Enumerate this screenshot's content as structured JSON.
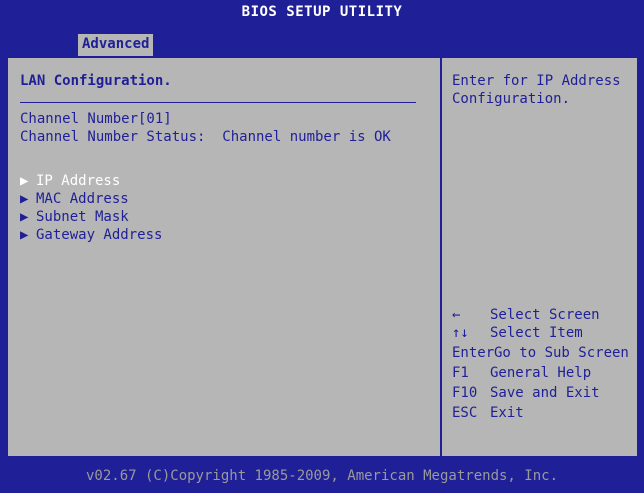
{
  "title_bar": {
    "title": "BIOS SETUP UTILITY"
  },
  "tabs": [
    {
      "label": "Advanced",
      "active": true
    }
  ],
  "main": {
    "section_title": "LAN Configuration.",
    "channel_number": "Channel Number[01]",
    "channel_status": "Channel Number Status:  Channel number is OK",
    "menu_items": [
      {
        "arrow": "▶",
        "label": "IP Address",
        "selected": true
      },
      {
        "arrow": "▶",
        "label": "MAC Address",
        "selected": false
      },
      {
        "arrow": "▶",
        "label": "Subnet Mask",
        "selected": false
      },
      {
        "arrow": "▶",
        "label": "Gateway Address",
        "selected": false
      }
    ]
  },
  "help": {
    "line1": "Enter for IP Address",
    "line2": "Configuration.",
    "keys": [
      {
        "key": "←",
        "action": "Select Screen"
      },
      {
        "key": "↑↓",
        "action": "Select Item"
      },
      {
        "key": "Enter",
        "action": "Go to Sub Screen"
      },
      {
        "key": "F1",
        "action": "General Help"
      },
      {
        "key": "F10",
        "action": "Save and Exit"
      },
      {
        "key": "ESC",
        "action": "Exit"
      }
    ]
  },
  "footer": {
    "text": "v02.67 (C)Copyright 1985-2009, American Megatrends, Inc."
  },
  "colors": {
    "background_blue": "#1f1f97",
    "panel_gray": "#b6b6b6",
    "highlight_text": "#ffffff",
    "footer_text": "#9a9a9a"
  }
}
